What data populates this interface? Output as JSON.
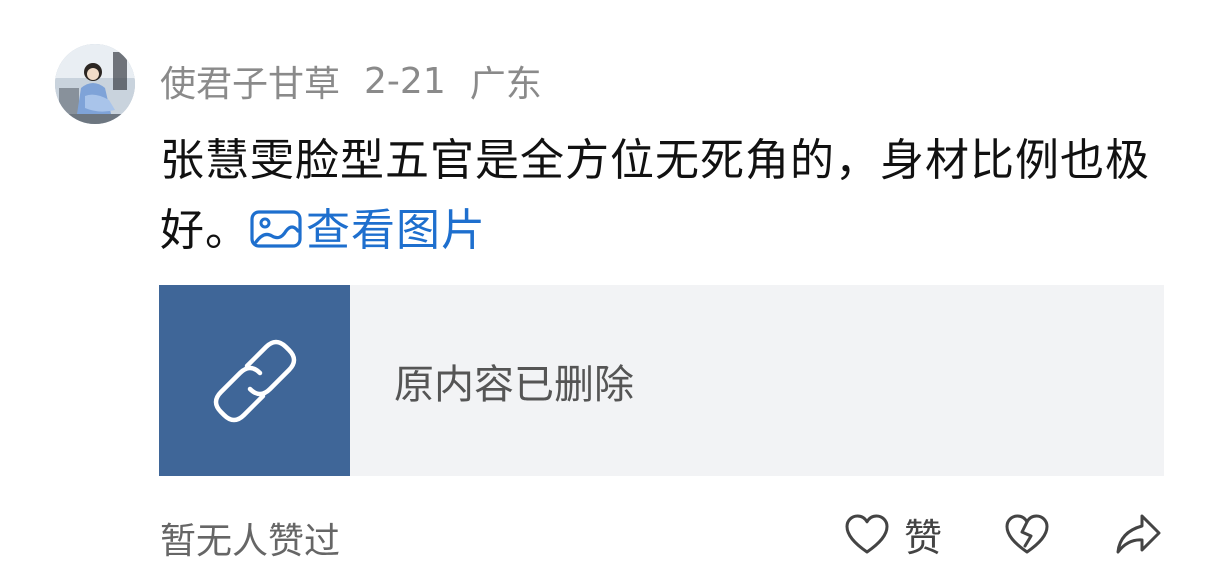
{
  "comment": {
    "author": "使君子甘草",
    "date": "2-21",
    "location": "广东",
    "text": "张慧雯脸型五官是全方位无死角的，身材比例也极好。",
    "view_image_label": "查看图片"
  },
  "link_card": {
    "title": "原内容已删除",
    "thumb_color": "#3f6698",
    "icon": "chain-link-icon"
  },
  "footer": {
    "likes_text": "暂无人赞过",
    "like_label": "赞"
  },
  "colors": {
    "link_blue": "#1e6fce",
    "meta_gray": "#8a8a8a",
    "card_bg": "#f2f3f5"
  }
}
